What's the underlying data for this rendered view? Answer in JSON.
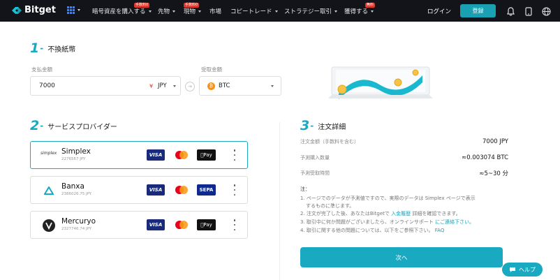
{
  "nav": {
    "brand": "Bitget",
    "items": [
      {
        "label": "暗号資産を購入する",
        "badge": "手数料0",
        "caret": true
      },
      {
        "label": "先物",
        "badge": "",
        "caret": true
      },
      {
        "label": "現物",
        "badge": "手数料0",
        "caret": true
      },
      {
        "label": "市場",
        "badge": "",
        "caret": false
      },
      {
        "label": "コピートレード",
        "badge": "",
        "caret": true
      },
      {
        "label": "ストラテジー取引",
        "badge": "",
        "caret": true
      },
      {
        "label": "獲得する",
        "badge": "無料",
        "caret": true
      }
    ],
    "login": "ログイン",
    "signup": "登録"
  },
  "step1": {
    "num": "1",
    "title": "不換紙幣"
  },
  "pay": {
    "label": "支払金額",
    "value": "7000",
    "currency": "JPY",
    "currency_symbol": "¥"
  },
  "receive": {
    "label": "受取金額",
    "currency": "BTC",
    "currency_symbol": "₿"
  },
  "step2": {
    "num": "2",
    "title": "サービスプロバイダー"
  },
  "providers": [
    {
      "name": "Simplex",
      "value": "2276567 JPY",
      "logo": "simplex",
      "logo_text": "simplex",
      "third": "Pay",
      "third_type": "applepay",
      "selected": true
    },
    {
      "name": "Banxa",
      "value": "2386026.75 JPY",
      "logo": "banxa",
      "logo_text": "",
      "third": "SEPA",
      "third_type": "sepa",
      "selected": false
    },
    {
      "name": "Mercuryo",
      "value": "2327746.74 JPY",
      "logo": "mercuryo",
      "logo_text": "",
      "third": "Pay",
      "third_type": "applepay",
      "selected": false
    }
  ],
  "card_labels": {
    "visa": "VISA"
  },
  "step3": {
    "num": "3",
    "title": "注文詳細"
  },
  "details": [
    {
      "key": "注文金額（手数料を含む）",
      "value": "7000 JPY"
    },
    {
      "key": "予測購入数量",
      "value": "≈0.003074 BTC"
    },
    {
      "key": "予測受取時間",
      "value": "≈5~30 分"
    }
  ],
  "notes": {
    "title": "注：",
    "line1": "1. ページでのデータが予測値ですので、実際のデータは Simplex ページで表示",
    "line1b": "するものに準じます。",
    "line2a": "2. 注文が完了した後、あなたはBitgetで ",
    "line2_link": "入金履歴",
    "line2b": " 詳細を確認できます。",
    "line3a": "3. 取引中に何か問題がございましたら、オンラインサポート ",
    "line3_link": "にご連絡下さい。",
    "line4a": "4. 取引に関する他の問題については、以下をご参照下さい。 ",
    "line4_link": "FAQ"
  },
  "next_button": "次へ",
  "help_button": "ヘルプ",
  "colors": {
    "accent": "#19a9c0",
    "nav_bg": "#12141a"
  }
}
